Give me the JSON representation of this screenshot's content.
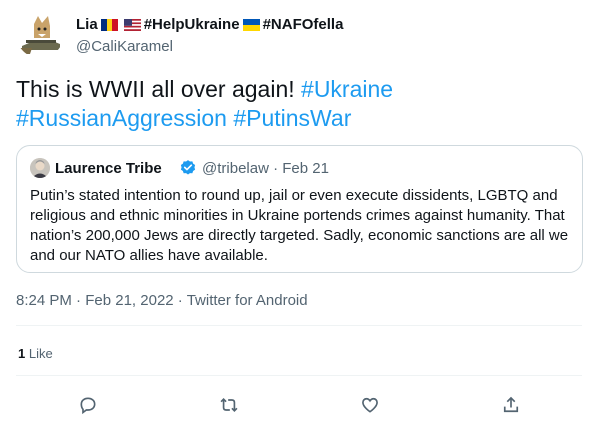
{
  "author": {
    "name_prefix": "Lia",
    "hashtag_help": "#HelpUkraine",
    "hashtag_nafo": "#NAFOfella",
    "handle": "@CaliKaramel",
    "flag_icons": [
      "romania-flag-icon",
      "usa-flag-icon",
      "ukraine-flag-icon"
    ]
  },
  "tweet": {
    "text_lead": "This is WWII all over again! ",
    "hashtags": [
      "#Ukraine",
      "#RussianAggression",
      "#PutinsWar"
    ]
  },
  "quoted": {
    "name": "Laurence Tribe",
    "handle": "@tribelaw",
    "separator": "·",
    "date": "Feb 21",
    "text": "Putin’s stated intention to round up, jail or even execute dissidents, LGBTQ and religious and ethnic minorities in Ukraine portends crimes against humanity. That nation’s 200,000 Jews are directly targeted. Sadly, economic sanctions are all we and our NATO allies have available."
  },
  "meta": {
    "time": "8:24 PM",
    "date": "Feb 21, 2022",
    "source": "Twitter for Android",
    "separator": "·"
  },
  "stats": {
    "likes_count": "1",
    "likes_label": "Like"
  },
  "actions": [
    "reply-icon",
    "retweet-icon",
    "like-icon",
    "share-icon"
  ],
  "colors": {
    "link": "#1d9bf0",
    "secondary": "#536471",
    "border": "#cfd9de",
    "verified": "#1d9bf0"
  }
}
